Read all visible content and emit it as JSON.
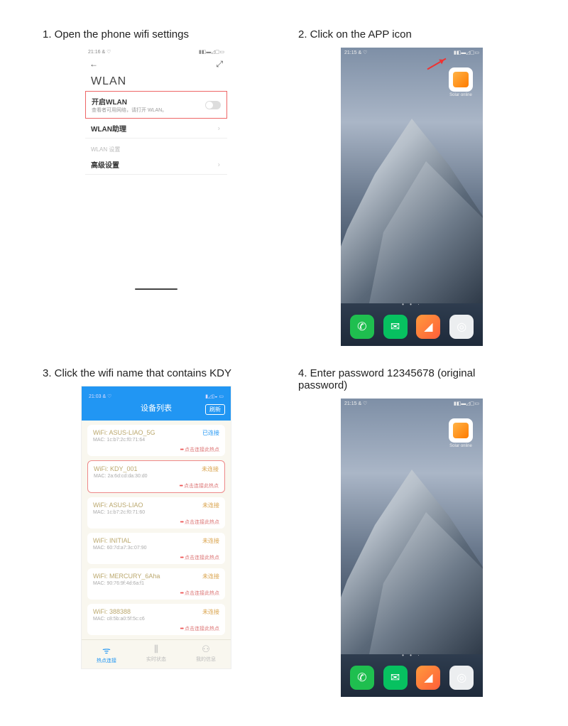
{
  "steps": {
    "s1": {
      "title": "1. Open the phone wifi settings"
    },
    "s2": {
      "title": "2. Click on the APP icon"
    },
    "s3": {
      "title": "3. Click the wifi name that contains KDY"
    },
    "s4": {
      "title": "4. Enter password 12345678 (original password)"
    }
  },
  "step1_ui": {
    "status_time": "21:16 & ♡",
    "status_icons": "▮◧▬◿▢▭",
    "back_arrow": "←",
    "scan_icon": "⤢",
    "page_title": "WLAN",
    "row_enable_title": "开启WLAN",
    "row_enable_sub": "查看者可用网络，请打开 WLAN。",
    "row_assist": "WLAN助理",
    "section_label": "WLAN 设置",
    "row_advanced": "高级设置"
  },
  "homescreen": {
    "status_time": "21:15 & ♡",
    "status_icons": "▮◧▬◿▢▭",
    "app_label": "Solar online",
    "page_dots": "• • ·"
  },
  "step3_ui": {
    "status_time": "21:03 & ♡",
    "status_icons": "▮◿▯◒ ▭",
    "header_title": "设备列表",
    "refresh_btn": "刷新",
    "status_connected": "已连接",
    "status_not_connected": "未连接",
    "hint_text": "点击连接此热点",
    "networks": [
      {
        "name": "WiFi: ASUS-LIAO_5G",
        "mac": "MAC: 1c:b7:2c:f0:71:64",
        "connected": true
      },
      {
        "name": "WiFi: KDY_001",
        "mac": "MAC: 2a:6d:cd:da:30:d0",
        "connected": false,
        "selected": true
      },
      {
        "name": "WiFi: ASUS-LIAO",
        "mac": "MAC: 1c:b7:2c:f0:71:60",
        "connected": false
      },
      {
        "name": "WiFi: INITIAL",
        "mac": "MAC: 60:7d:a7:3c:07:90",
        "connected": false
      },
      {
        "name": "WiFi: MERCURY_6Aha",
        "mac": "MAC: 90:76:9f:4d:6a:f1",
        "connected": false
      },
      {
        "name": "WiFi: 388388",
        "mac": "MAC: c8:5b:a0:5f:5c:c6",
        "connected": false
      }
    ],
    "tabs": {
      "hotspot": "热点连接",
      "realtime": "实时状态",
      "mine": "我的信息"
    }
  }
}
